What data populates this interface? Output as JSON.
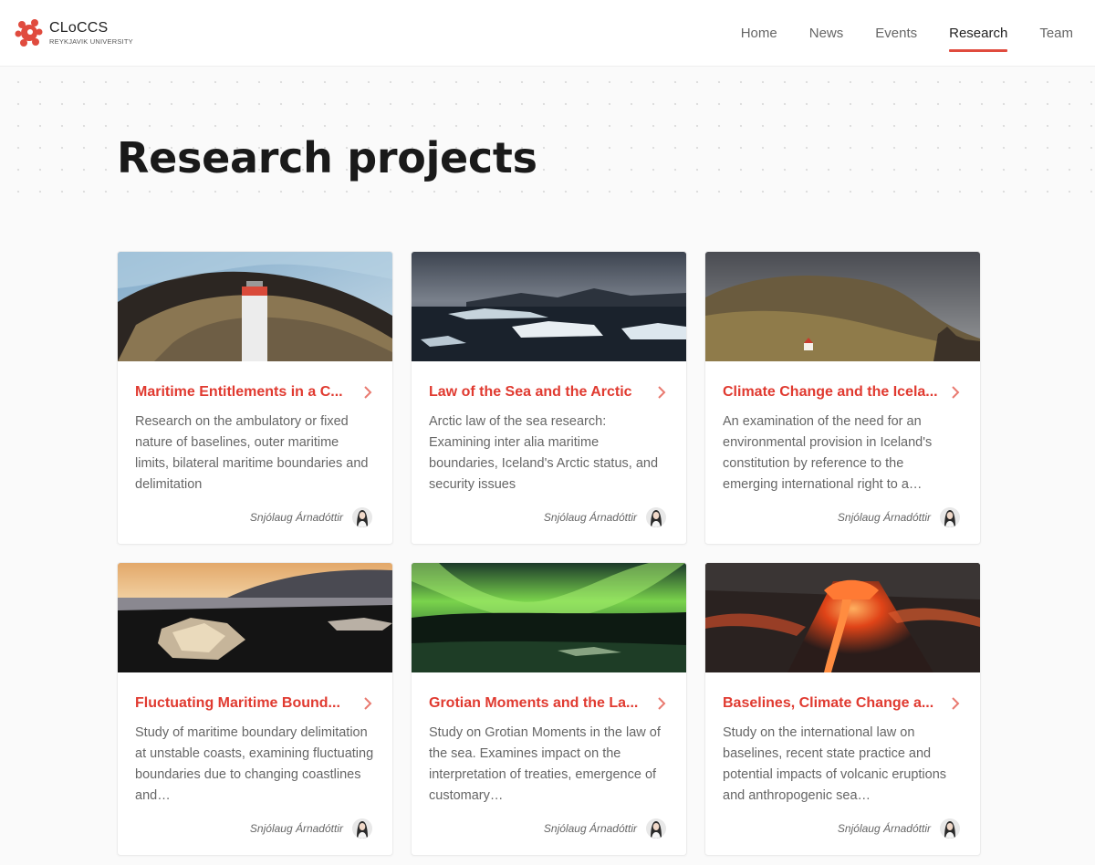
{
  "brand": {
    "name": "CLoCCS",
    "subtitle": "REYKJAVIK UNIVERSITY",
    "accent": "#e04b3e"
  },
  "nav": {
    "items": [
      {
        "label": "Home"
      },
      {
        "label": "News"
      },
      {
        "label": "Events"
      },
      {
        "label": "Research",
        "active": true
      },
      {
        "label": "Team"
      }
    ]
  },
  "page": {
    "title": "Research projects"
  },
  "cards": [
    {
      "title": "Maritime Entitlements in a C...",
      "description": "Research on the ambulatory or fixed nature of baselines, outer maritime limits, bilateral maritime boundaries and delimitation",
      "author": "Snjólaug Árnadóttir",
      "image": "lighthouse-coast"
    },
    {
      "title": "Law of the Sea and the Arctic",
      "description": "Arctic law of the sea research: Examining inter alia maritime boundaries, Iceland's Arctic status, and security issues",
      "author": "Snjólaug Árnadóttir",
      "image": "ice-lagoon"
    },
    {
      "title": "Climate Change and the Icela...",
      "description": "An examination of the need for an environmental provision in Iceland's constitution by reference to the emerging international right to a…",
      "author": "Snjólaug Árnadóttir",
      "image": "mountain-church"
    },
    {
      "title": "Fluctuating Maritime Bound...",
      "description": "Study of maritime boundary delimitation at unstable coasts, examining fluctuating boundaries due to changing coastlines and…",
      "author": "Snjólaug Árnadóttir",
      "image": "ice-beach-sunset"
    },
    {
      "title": "Grotian Moments and the La...",
      "description": "Study on Grotian Moments in the law of the sea. Examines impact on the interpretation of treaties, emergence of customary…",
      "author": "Snjólaug Árnadóttir",
      "image": "aurora"
    },
    {
      "title": "Baselines, Climate Change a...",
      "description": "Study on the international law on baselines, recent state practice and potential impacts of volcanic eruptions and anthropogenic sea…",
      "author": "Snjólaug Árnadóttir",
      "image": "volcano"
    }
  ]
}
